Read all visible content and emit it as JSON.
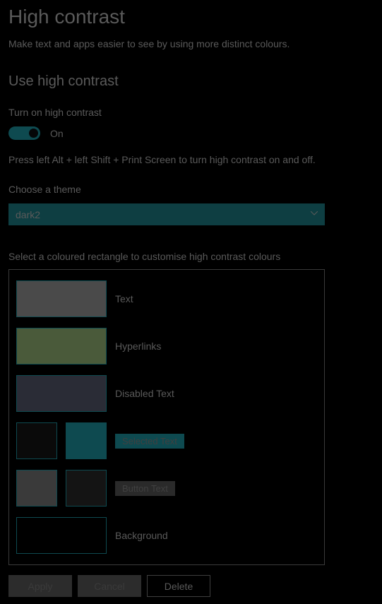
{
  "page": {
    "title": "High contrast",
    "description": "Make text and apps easier to see by using more distinct colours."
  },
  "section": {
    "header": "Use high contrast",
    "toggle_label": "Turn on high contrast",
    "toggle_state": "On",
    "hint": "Press left Alt + left Shift + Print Screen to turn high contrast on and off.",
    "theme_label": "Choose a theme",
    "theme_value": "dark2",
    "customise_label": "Select a coloured rectangle to customise high contrast colours"
  },
  "swatches": {
    "text": {
      "label": "Text",
      "color": "#4a4a4a"
    },
    "hyperlinks": {
      "label": "Hyperlinks",
      "color": "#4a5a3a"
    },
    "disabled": {
      "label": "Disabled Text",
      "color": "#2a2c36"
    },
    "selected": {
      "label": "Selected Text",
      "fg": "#0a0a0a",
      "bg": "#0e4a50",
      "chip_bg": "#0e4a50"
    },
    "button": {
      "label": "Button Text",
      "fg": "#3a3a3a",
      "bg": "#141414",
      "chip_bg": "#2a2a2a"
    },
    "background": {
      "label": "Background",
      "color": "#000000"
    }
  },
  "buttons": {
    "apply": "Apply",
    "cancel": "Cancel",
    "delete": "Delete"
  }
}
